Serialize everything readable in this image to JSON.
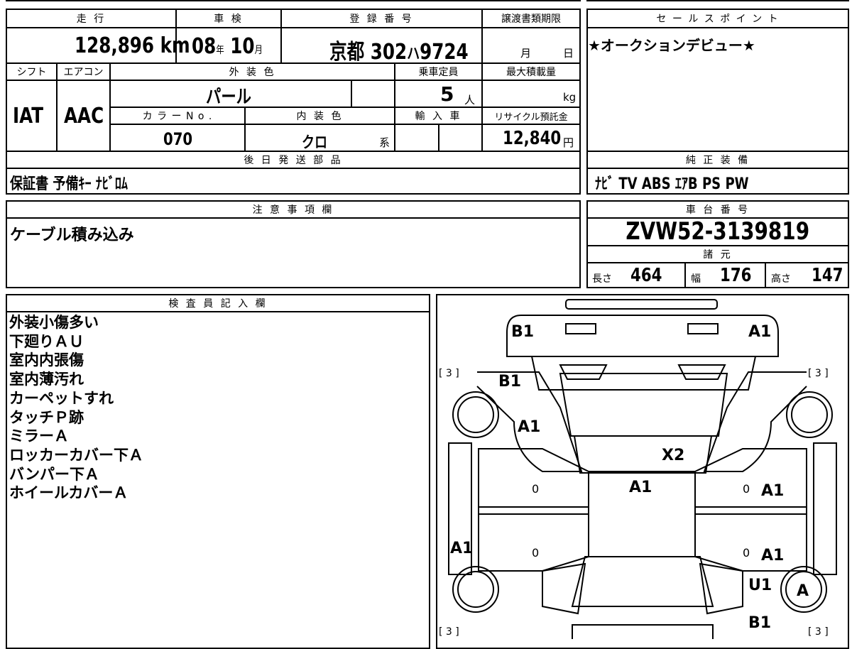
{
  "headers": {
    "mileage": "走 行",
    "inspection": "車 検",
    "registration": "登 録 番 号",
    "transfer_deadline": "譲渡書類期限",
    "shift": "シフト",
    "ac": "エアコン",
    "exterior_color": "外 装 色",
    "capacity": "乗車定員",
    "max_load": "最大積載量",
    "color_no": "カ ラ ー N o .",
    "interior_color": "内 装 色",
    "import": "輸 入 車",
    "recycle": "リサイクル預託金",
    "later_parts": "後 日 発 送 部 品",
    "sales_point": "セ ー ル ス ポ イ ン ト",
    "genuine_equipment": "純 正 装 備",
    "notes": "注 意 事 項 欄",
    "chassis_no": "車 台 番 号",
    "specs": "諸 元",
    "inspector": "検 査 員 記 入 欄"
  },
  "vehicle": {
    "mileage_value": "128,896",
    "mileage_unit": "km",
    "inspection_year": "08",
    "inspection_year_unit": "年",
    "inspection_month": "10",
    "inspection_month_unit": "月",
    "reg_area": "京都",
    "reg_class": "302",
    "reg_kana": "ハ",
    "reg_number": "9724",
    "deadline_month": "月",
    "deadline_day": "日",
    "shift": "IAT",
    "ac": "AAC",
    "exterior_color": "パール",
    "capacity": "5",
    "capacity_unit": "人",
    "max_load_unit": "kg",
    "color_no": "070",
    "interior_color": "クロ",
    "interior_suffix": "系",
    "recycle_fee": "12,840",
    "recycle_unit": "円",
    "later_parts": "保証書 予備ｷｰ ﾅﾋﾞﾛﾑ",
    "sales_point": "★オークションデビュー★",
    "genuine_equipment": "ﾅﾋﾞ TV ABS ｴｱB PS PW",
    "notes": "ケーブル積み込み",
    "chassis_no": "ZVW52-3139819",
    "length_label": "長さ",
    "length": "464",
    "width_label": "幅",
    "width": "176",
    "height_label": "高さ",
    "height": "147"
  },
  "inspector_notes": [
    "外装小傷多い",
    "下廻りＡＵ",
    "室内内張傷",
    "室内薄汚れ",
    "カーペットすれ",
    "タッチＰ跡",
    "ミラーＡ",
    "ロッカーカバー下Ａ",
    "バンパー下Ａ",
    "ホイールカバーＡ"
  ],
  "damage_map": {
    "corner_labels": [
      "[ 3 ]",
      "[ 3 ]",
      "[ 3 ]",
      "[ 3 ]"
    ],
    "marks": [
      {
        "code": "B1",
        "location": "front-bumper-left"
      },
      {
        "code": "A1",
        "location": "front-bumper-right"
      },
      {
        "code": "B1",
        "location": "front-fender-left"
      },
      {
        "code": "A1",
        "location": "front-door-area-left"
      },
      {
        "code": "X2",
        "location": "windshield"
      },
      {
        "code": "A1",
        "location": "roof"
      },
      {
        "code": "A1",
        "location": "front-door-right"
      },
      {
        "code": "A1",
        "location": "rocker-left"
      },
      {
        "code": "A1",
        "location": "rear-door-right"
      },
      {
        "code": "U1",
        "location": "rear-fender-right"
      },
      {
        "code": "A",
        "location": "rear-wheel-right"
      },
      {
        "code": "B1",
        "location": "rear-bumper-right"
      }
    ],
    "small_zeros": [
      "0",
      "0",
      "0",
      "0"
    ]
  }
}
